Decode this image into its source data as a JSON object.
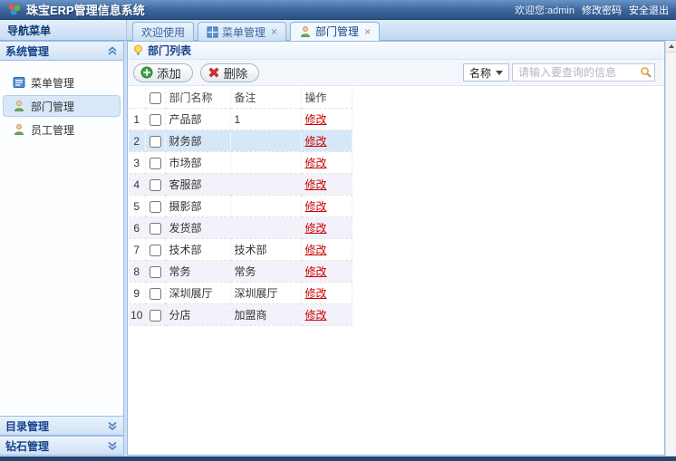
{
  "header": {
    "title": "珠宝ERP管理信息系统",
    "welcome": "欢迎您:admin",
    "links": [
      "修改密码",
      "安全退出"
    ]
  },
  "sidebar": {
    "title": "导航菜单",
    "sections": [
      {
        "id": "system-mgmt",
        "label": "系统管理",
        "expanded": true,
        "items": [
          {
            "id": "menu-mgmt",
            "label": "菜单管理",
            "icon": "menu-icon",
            "selected": false
          },
          {
            "id": "dept-mgmt",
            "label": "部门管理",
            "icon": "person-icon",
            "selected": true
          },
          {
            "id": "staff-mgmt",
            "label": "员工管理",
            "icon": "person-icon",
            "selected": false
          }
        ]
      },
      {
        "id": "catalog-mgmt",
        "label": "目录管理",
        "expanded": false
      },
      {
        "id": "diamond-mgmt",
        "label": "钻石管理",
        "expanded": false
      }
    ]
  },
  "tabs": [
    {
      "id": "welcome",
      "label": "欢迎使用",
      "icon": null,
      "closable": false,
      "active": false
    },
    {
      "id": "menu-mgmt",
      "label": "菜单管理",
      "icon": "grid-icon",
      "closable": true,
      "active": false
    },
    {
      "id": "dept-mgmt",
      "label": "部门管理",
      "icon": "person-icon",
      "closable": true,
      "active": true
    }
  ],
  "panel": {
    "title": "部门列表",
    "toolbar": {
      "add_label": "添加",
      "delete_label": "删除",
      "search_field_label": "名称",
      "search_placeholder": "请输入要查询的信息"
    },
    "table": {
      "columns": [
        "部门名称",
        "备注",
        "操作"
      ],
      "action_label": "修改",
      "rows": [
        {
          "num": 1,
          "name": "产品部",
          "remark": "1",
          "selected": false
        },
        {
          "num": 2,
          "name": "财务部",
          "remark": "",
          "selected": true
        },
        {
          "num": 3,
          "name": "市场部",
          "remark": "",
          "selected": false
        },
        {
          "num": 4,
          "name": "客服部",
          "remark": "",
          "selected": false
        },
        {
          "num": 5,
          "name": "摄影部",
          "remark": "",
          "selected": false
        },
        {
          "num": 6,
          "name": "发货部",
          "remark": "",
          "selected": false
        },
        {
          "num": 7,
          "name": "技术部",
          "remark": "技术部",
          "selected": false
        },
        {
          "num": 8,
          "name": "常务",
          "remark": "常务",
          "selected": false
        },
        {
          "num": 9,
          "name": "深圳展厅",
          "remark": "深圳展厅",
          "selected": false
        },
        {
          "num": 10,
          "name": "分店",
          "remark": "加盟商",
          "selected": false
        }
      ]
    }
  },
  "colors": {
    "titlebar_top": "#6a93c4",
    "titlebar_bottom": "#2b5183",
    "panel_border": "#95b8e7",
    "selected_row_bg": "#d6e7f8",
    "alt_row_bg": "#f3f1f9",
    "modify_link_red": "#cc0000",
    "add_icon_green": "#3aa53a",
    "delete_icon_red": "#d2332c"
  }
}
